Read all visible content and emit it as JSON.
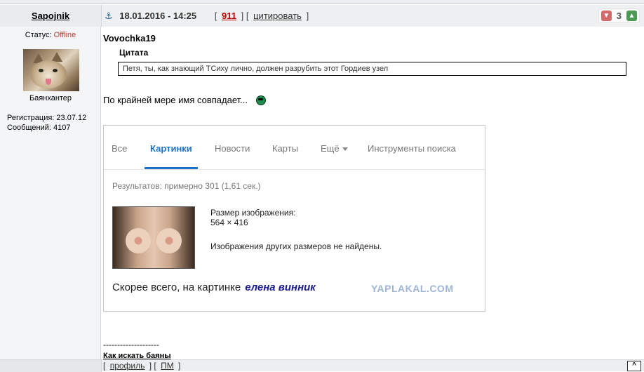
{
  "post": {
    "author": "Sapojnik",
    "date": "18.01.2016 - 14:25",
    "post_number": "911",
    "quote_label": "цитировать",
    "rating": {
      "count": "3"
    }
  },
  "user": {
    "status_label": "Статус:",
    "status_value": "Offline",
    "rank": "Баянхантер",
    "registration": "Регистрация: 23.07.12",
    "messages": "Сообщений: 4107"
  },
  "content": {
    "quote_author": "Vovochka19",
    "quote_title": "Цитата",
    "quote_text": "Петя, ты, как знающий ТСиху лично, должен разрубить этот Гордиев узел",
    "text": "По крайней мере имя совпадает..."
  },
  "embed": {
    "tabs": [
      "Все",
      "Картинки",
      "Новости",
      "Карты",
      "Ещё",
      "Инструменты поиска"
    ],
    "active_tab": "Картинки",
    "results": "Результатов: примерно 301 (1,61 сек.)",
    "size_label": "Размер изображения:",
    "size_value": "564 × 416",
    "no_other_sizes": "Изображения других размеров не найдены.",
    "guess_prefix": "Скорее всего, на картинке",
    "guess_name": "елена винник",
    "watermark": "YAPLAKAL.COM"
  },
  "signature": {
    "dashes": "--------------------",
    "link": "Как искать баяны"
  },
  "footer": {
    "profile": "профиль",
    "pm": "ПМ",
    "to_top": "^"
  },
  "colors": {
    "accent_blue": "#1a73c8",
    "offline_red": "#c0392b",
    "post_number_red": "#c00000"
  }
}
